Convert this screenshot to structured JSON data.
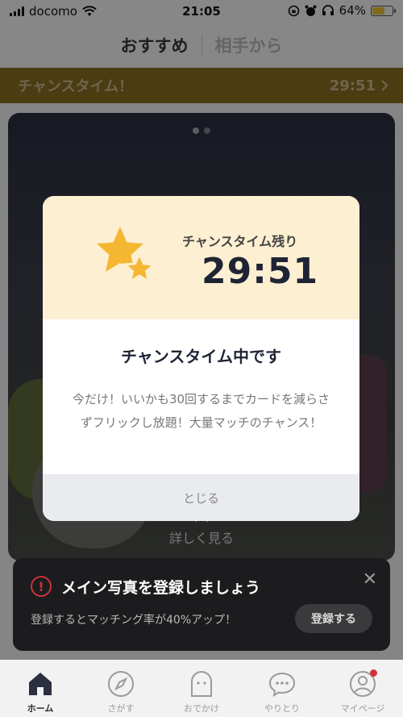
{
  "status_bar": {
    "carrier": "docomo",
    "time": "21:05",
    "battery": "64%",
    "battery_level": 0.64
  },
  "header": {
    "tabs": [
      {
        "label": "おすすめ",
        "active": true
      },
      {
        "label": "相手から",
        "active": false
      }
    ]
  },
  "banner": {
    "label": "チャンスタイム！",
    "countdown": "29:51"
  },
  "card": {
    "more_label": "詳しく見る"
  },
  "modal": {
    "remaining_label": "チャンスタイム残り",
    "timer": "29:51",
    "title": "チャンスタイム中です",
    "description": "今だけ！いいかも30回するまでカードを減らさずフリックし放題！大量マッチのチャンス！",
    "close_label": "とじる",
    "star_color": "#f5b731"
  },
  "toast": {
    "title": "メイン写真を登録しましょう",
    "subtitle": "登録するとマッチング率が40%アップ！",
    "button_label": "登録する",
    "warn_color": "#c9313a"
  },
  "nav": {
    "items": [
      {
        "label": "ホーム",
        "icon": "home-icon",
        "active": true
      },
      {
        "label": "さがす",
        "icon": "compass-icon",
        "active": false
      },
      {
        "label": "おでかけ",
        "icon": "ghost-icon",
        "active": false
      },
      {
        "label": "やりとり",
        "icon": "chat-icon",
        "active": false
      },
      {
        "label": "マイページ",
        "icon": "profile-icon",
        "active": false
      }
    ]
  }
}
